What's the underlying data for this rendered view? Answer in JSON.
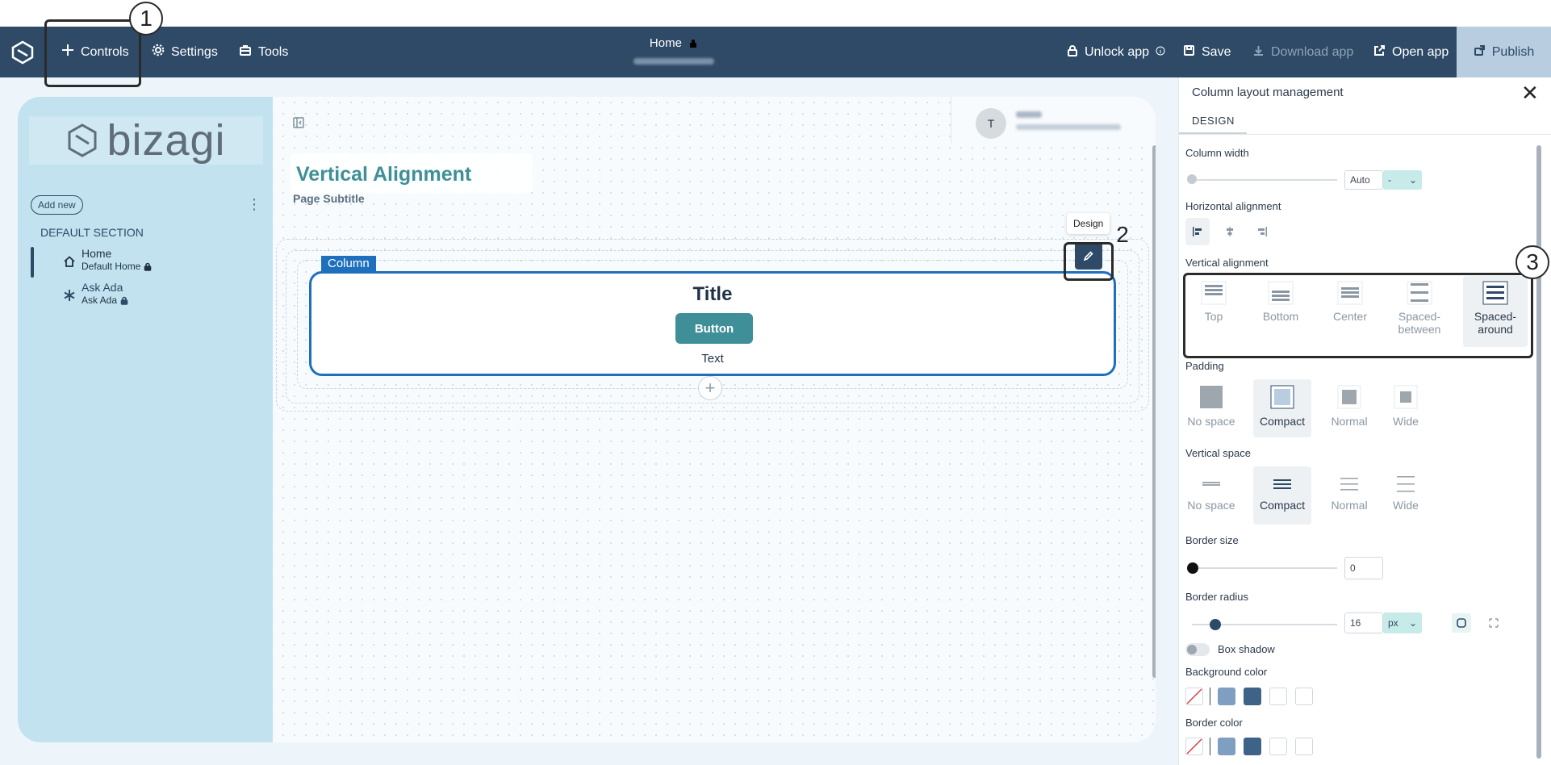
{
  "topbar": {
    "controls": "Controls",
    "settings": "Settings",
    "tools": "Tools",
    "home": "Home",
    "unlock": "Unlock app",
    "save": "Save",
    "download": "Download app",
    "open": "Open app",
    "publish": "Publish"
  },
  "callouts": [
    "1",
    "2",
    "3"
  ],
  "sidebar": {
    "logo_text": "bizagi",
    "add_new": "Add new",
    "kebab": "⋮",
    "section": "DEFAULT SECTION",
    "items": [
      {
        "label": "Home",
        "sub": "Default Home"
      },
      {
        "label": "Ask Ada",
        "sub": "Ask Ada"
      }
    ]
  },
  "main": {
    "avatar_initial": "T",
    "page_title": "Vertical Alignment",
    "page_subtitle": "Page Subtitle",
    "column_tag": "Column",
    "column_title": "Title",
    "column_button": "Button",
    "column_text": "Text",
    "add_symbol": "+",
    "tooltip": "Design"
  },
  "panel": {
    "title": "Column layout management",
    "close": "✕",
    "tab": "DESIGN",
    "column_width": {
      "label": "Column width",
      "value": "Auto",
      "unit": "-"
    },
    "horizontal_alignment": {
      "label": "Horizontal alignment"
    },
    "vertical_alignment": {
      "label": "Vertical alignment",
      "options": [
        "Top",
        "Bottom",
        "Center",
        "Spaced-between",
        "Spaced-around"
      ],
      "selected": "Spaced-around"
    },
    "padding": {
      "label": "Padding",
      "options": [
        "No space",
        "Compact",
        "Normal",
        "Wide"
      ],
      "selected": "Compact"
    },
    "vertical_space": {
      "label": "Vertical space",
      "options": [
        "No space",
        "Compact",
        "Normal",
        "Wide"
      ],
      "selected": "Compact"
    },
    "border_size": {
      "label": "Border size",
      "value": "0"
    },
    "border_radius": {
      "label": "Border radius",
      "value": "16",
      "unit": "px"
    },
    "box_shadow": {
      "label": "Box shadow"
    },
    "background_color": {
      "label": "Background color"
    },
    "border_color": {
      "label": "Border color"
    }
  },
  "colors": {
    "topbar": "#2e4a66",
    "accent": "#3f8f98",
    "selection": "#1f6fbf",
    "swatch_light": "#7f9fc0",
    "swatch_dark": "#3f6288"
  }
}
